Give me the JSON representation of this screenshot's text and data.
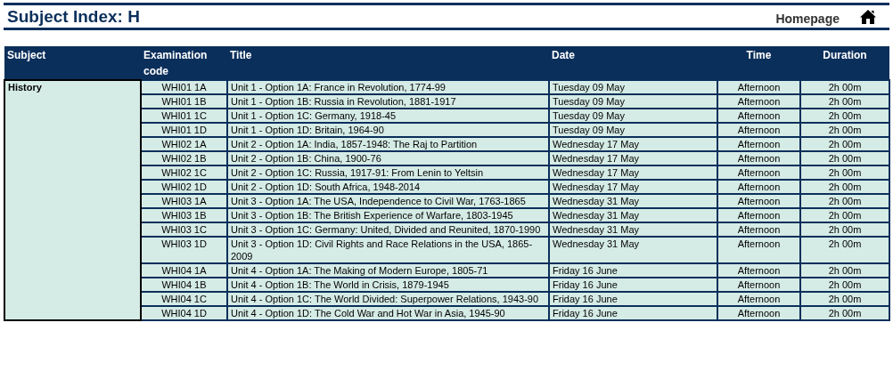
{
  "page": {
    "title": "Subject Index: H",
    "homepage_link": "Homepage"
  },
  "table": {
    "columns": [
      "Subject",
      "Examination code",
      "Title",
      "Date",
      "Time",
      "Duration"
    ],
    "subject": "History",
    "rows": [
      {
        "code": "WHI01 1A",
        "title": "Unit 1 - Option 1A: France in Revolution, 1774-99",
        "date": "Tuesday 09 May",
        "time": "Afternoon",
        "duration": "2h 00m"
      },
      {
        "code": "WHI01 1B",
        "title": "Unit 1 - Option 1B: Russia in Revolution, 1881-1917",
        "date": "Tuesday 09 May",
        "time": "Afternoon",
        "duration": "2h 00m"
      },
      {
        "code": "WHI01 1C",
        "title": "Unit 1 - Option 1C: Germany, 1918-45",
        "date": "Tuesday 09 May",
        "time": "Afternoon",
        "duration": "2h 00m"
      },
      {
        "code": "WHI01 1D",
        "title": "Unit 1 - Option 1D: Britain, 1964-90",
        "date": "Tuesday 09 May",
        "time": "Afternoon",
        "duration": "2h 00m"
      },
      {
        "code": "WHI02 1A",
        "title": "Unit 2 - Option 1A: India, 1857-1948: The Raj to Partition",
        "date": "Wednesday 17 May",
        "time": "Afternoon",
        "duration": "2h 00m"
      },
      {
        "code": "WHI02 1B",
        "title": "Unit 2 - Option 1B: China, 1900-76",
        "date": "Wednesday 17 May",
        "time": "Afternoon",
        "duration": "2h 00m"
      },
      {
        "code": "WHI02 1C",
        "title": "Unit 2 - Option 1C: Russia, 1917-91: From Lenin to Yeltsin",
        "date": "Wednesday 17 May",
        "time": "Afternoon",
        "duration": "2h 00m"
      },
      {
        "code": "WHI02 1D",
        "title": "Unit 2 - Option 1D: South Africa, 1948-2014",
        "date": "Wednesday 17 May",
        "time": "Afternoon",
        "duration": "2h 00m"
      },
      {
        "code": "WHI03 1A",
        "title": "Unit 3 - Option 1A: The USA, Independence to Civil War, 1763-1865",
        "date": "Wednesday 31 May",
        "time": "Afternoon",
        "duration": "2h 00m"
      },
      {
        "code": "WHI03 1B",
        "title": "Unit 3 - Option 1B: The British Experience of Warfare, 1803-1945",
        "date": "Wednesday 31 May",
        "time": "Afternoon",
        "duration": "2h 00m"
      },
      {
        "code": "WHI03 1C",
        "title": "Unit 3 - Option 1C: Germany: United, Divided and Reunited, 1870-1990",
        "date": "Wednesday 31 May",
        "time": "Afternoon",
        "duration": "2h 00m"
      },
      {
        "code": "WHI03 1D",
        "title": "Unit 3 - Option 1D: Civil Rights and Race Relations in the USA, 1865-2009",
        "date": "Wednesday 31 May",
        "time": "Afternoon",
        "duration": "2h 00m"
      },
      {
        "code": "WHI04 1A",
        "title": "Unit 4 - Option 1A: The Making of Modern Europe, 1805-71",
        "date": "Friday 16 June",
        "time": "Afternoon",
        "duration": "2h 00m"
      },
      {
        "code": "WHI04 1B",
        "title": "Unit 4 - Option 1B: The World in Crisis, 1879-1945",
        "date": "Friday 16 June",
        "time": "Afternoon",
        "duration": "2h 00m"
      },
      {
        "code": "WHI04 1C",
        "title": "Unit 4 - Option 1C: The World Divided: Superpower Relations, 1943-90",
        "date": "Friday 16 June",
        "time": "Afternoon",
        "duration": "2h 00m"
      },
      {
        "code": "WHI04 1D",
        "title": "Unit 4 - Option 1D: The Cold War and Hot War in Asia, 1945-90",
        "date": "Friday 16 June",
        "time": "Afternoon",
        "duration": "2h 00m"
      }
    ]
  }
}
